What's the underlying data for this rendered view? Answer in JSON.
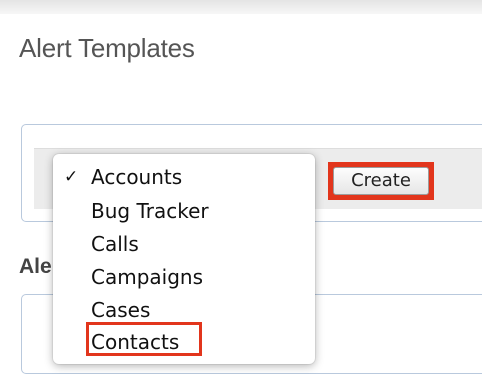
{
  "page": {
    "title": "Alert Templates"
  },
  "create_panel": {
    "selected_module": "Accounts",
    "create_label": "Create"
  },
  "section": {
    "heading": "Alert Templates"
  },
  "dropdown": {
    "checked_item": "Accounts",
    "checkmark_glyph": "✓",
    "options": [
      "Accounts",
      "Bug Tracker",
      "Calls",
      "Campaigns",
      "Cases",
      "Contacts"
    ],
    "highlighted_option": "Contacts"
  },
  "icons": {
    "checkmark": "checkmark-icon",
    "select_arrows": "select-arrows-icon"
  },
  "colors": {
    "highlight": "#e2351c",
    "panel_border": "#b9c9dd",
    "title_text": "#555555"
  }
}
